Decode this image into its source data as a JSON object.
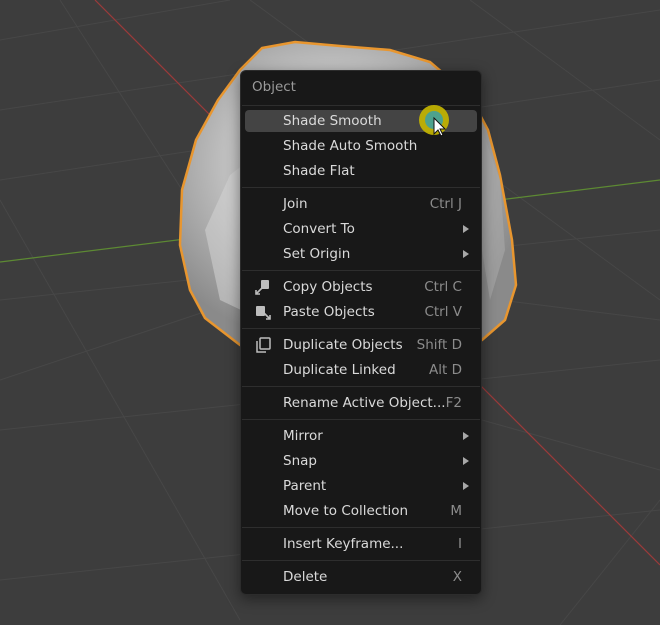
{
  "menu": {
    "title": "Object",
    "items": [
      {
        "label": "Shade Smooth",
        "shortcut": "",
        "submenu": false,
        "hover": true
      },
      {
        "label": "Shade Auto Smooth",
        "shortcut": "",
        "submenu": false
      },
      {
        "label": "Shade Flat",
        "shortcut": "",
        "submenu": false
      },
      {
        "label": "Join",
        "shortcut": "Ctrl J",
        "submenu": false
      },
      {
        "label": "Convert To",
        "shortcut": "",
        "submenu": true
      },
      {
        "label": "Set Origin",
        "shortcut": "",
        "submenu": true
      },
      {
        "label": "Copy Objects",
        "shortcut": "Ctrl C",
        "submenu": false,
        "icon": "copy-objects-icon"
      },
      {
        "label": "Paste Objects",
        "shortcut": "Ctrl V",
        "submenu": false,
        "icon": "paste-objects-icon"
      },
      {
        "label": "Duplicate Objects",
        "shortcut": "Shift D",
        "submenu": false,
        "icon": "duplicate-icon"
      },
      {
        "label": "Duplicate Linked",
        "shortcut": "Alt D",
        "submenu": false
      },
      {
        "label": "Rename Active Object...",
        "shortcut": "F2",
        "submenu": false
      },
      {
        "label": "Mirror",
        "shortcut": "",
        "submenu": true
      },
      {
        "label": "Snap",
        "shortcut": "",
        "submenu": true
      },
      {
        "label": "Parent",
        "shortcut": "",
        "submenu": true
      },
      {
        "label": "Move to Collection",
        "shortcut": "M",
        "submenu": false
      },
      {
        "label": "Insert Keyframe...",
        "shortcut": "I",
        "submenu": false
      },
      {
        "label": "Delete",
        "shortcut": "X",
        "submenu": false
      }
    ]
  },
  "colors": {
    "viewport_bg": "#3d3d3d",
    "menu_bg": "#181818",
    "hover_bg": "#444444",
    "selection_outline": "#e8962f",
    "axis_x": "#9b3a3a",
    "axis_y": "#5d8a33",
    "cursor_highlight": "#c8b800"
  }
}
